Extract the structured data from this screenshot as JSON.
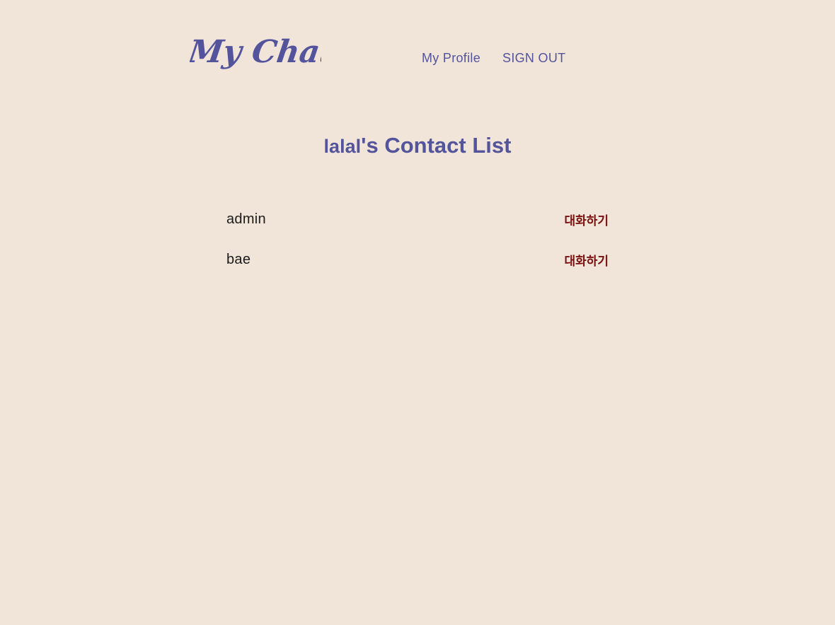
{
  "logo": {
    "text": "My Chat"
  },
  "nav": {
    "profile_label": "My Profile",
    "signout_label": "SIGN OUT"
  },
  "title": {
    "username": "lalal",
    "suffix": "'s Contact List"
  },
  "contacts": [
    {
      "name": "admin",
      "action_label": "대화하기"
    },
    {
      "name": "bae",
      "action_label": "대화하기"
    }
  ],
  "colors": {
    "background": "#f1e5d9",
    "accent": "#54549c",
    "action": "#7a0f0f"
  }
}
